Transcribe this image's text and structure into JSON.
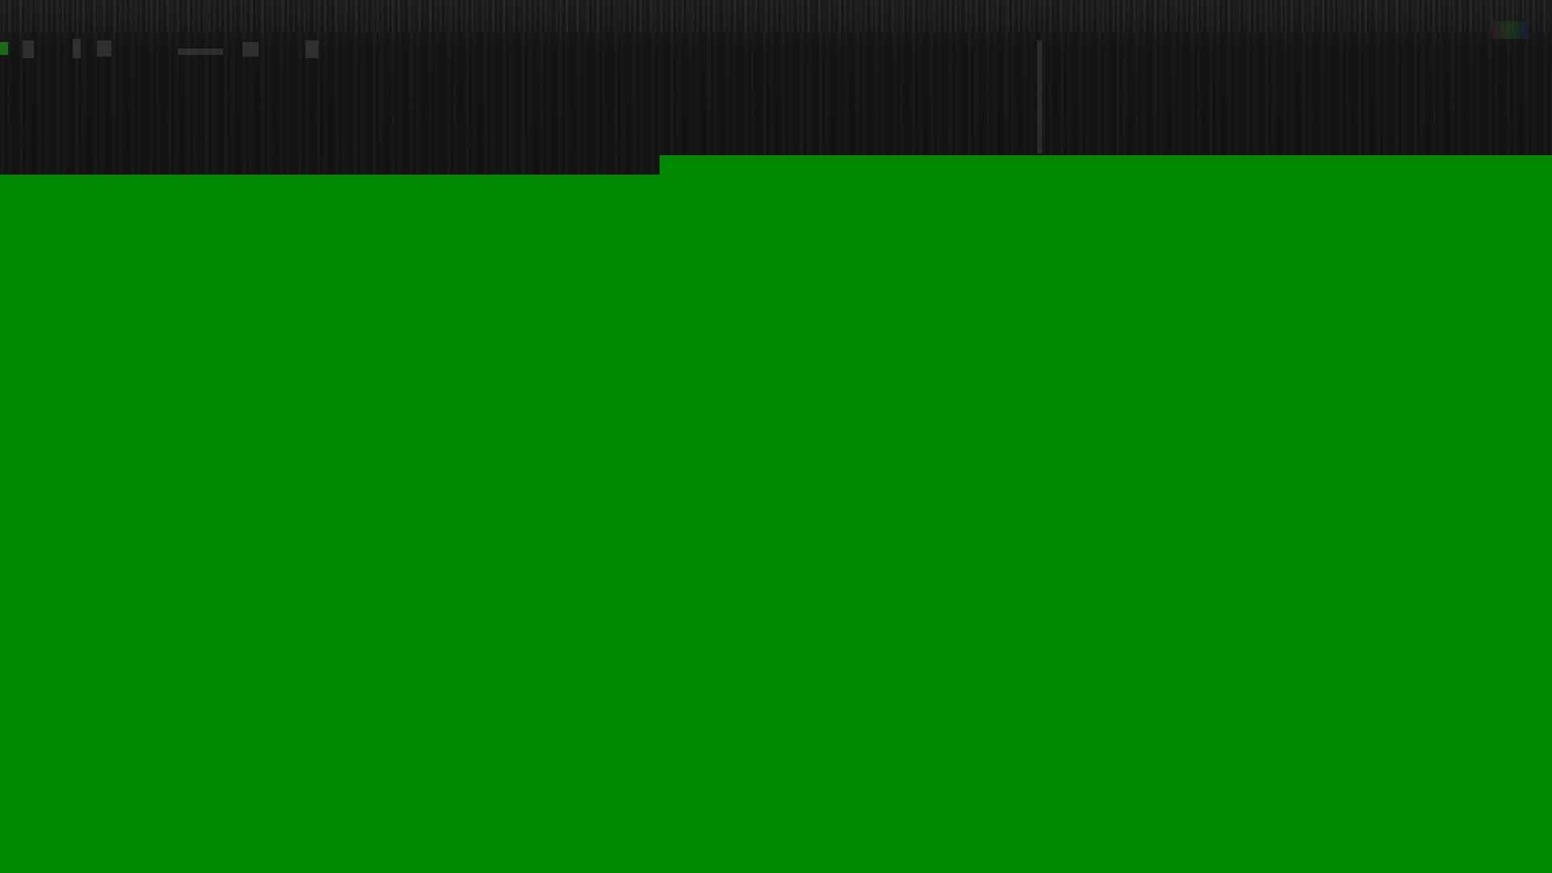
{
  "screen": {
    "description_state": "corrupted-frame",
    "colors": {
      "fill": "#008800",
      "band": "#141414"
    }
  }
}
